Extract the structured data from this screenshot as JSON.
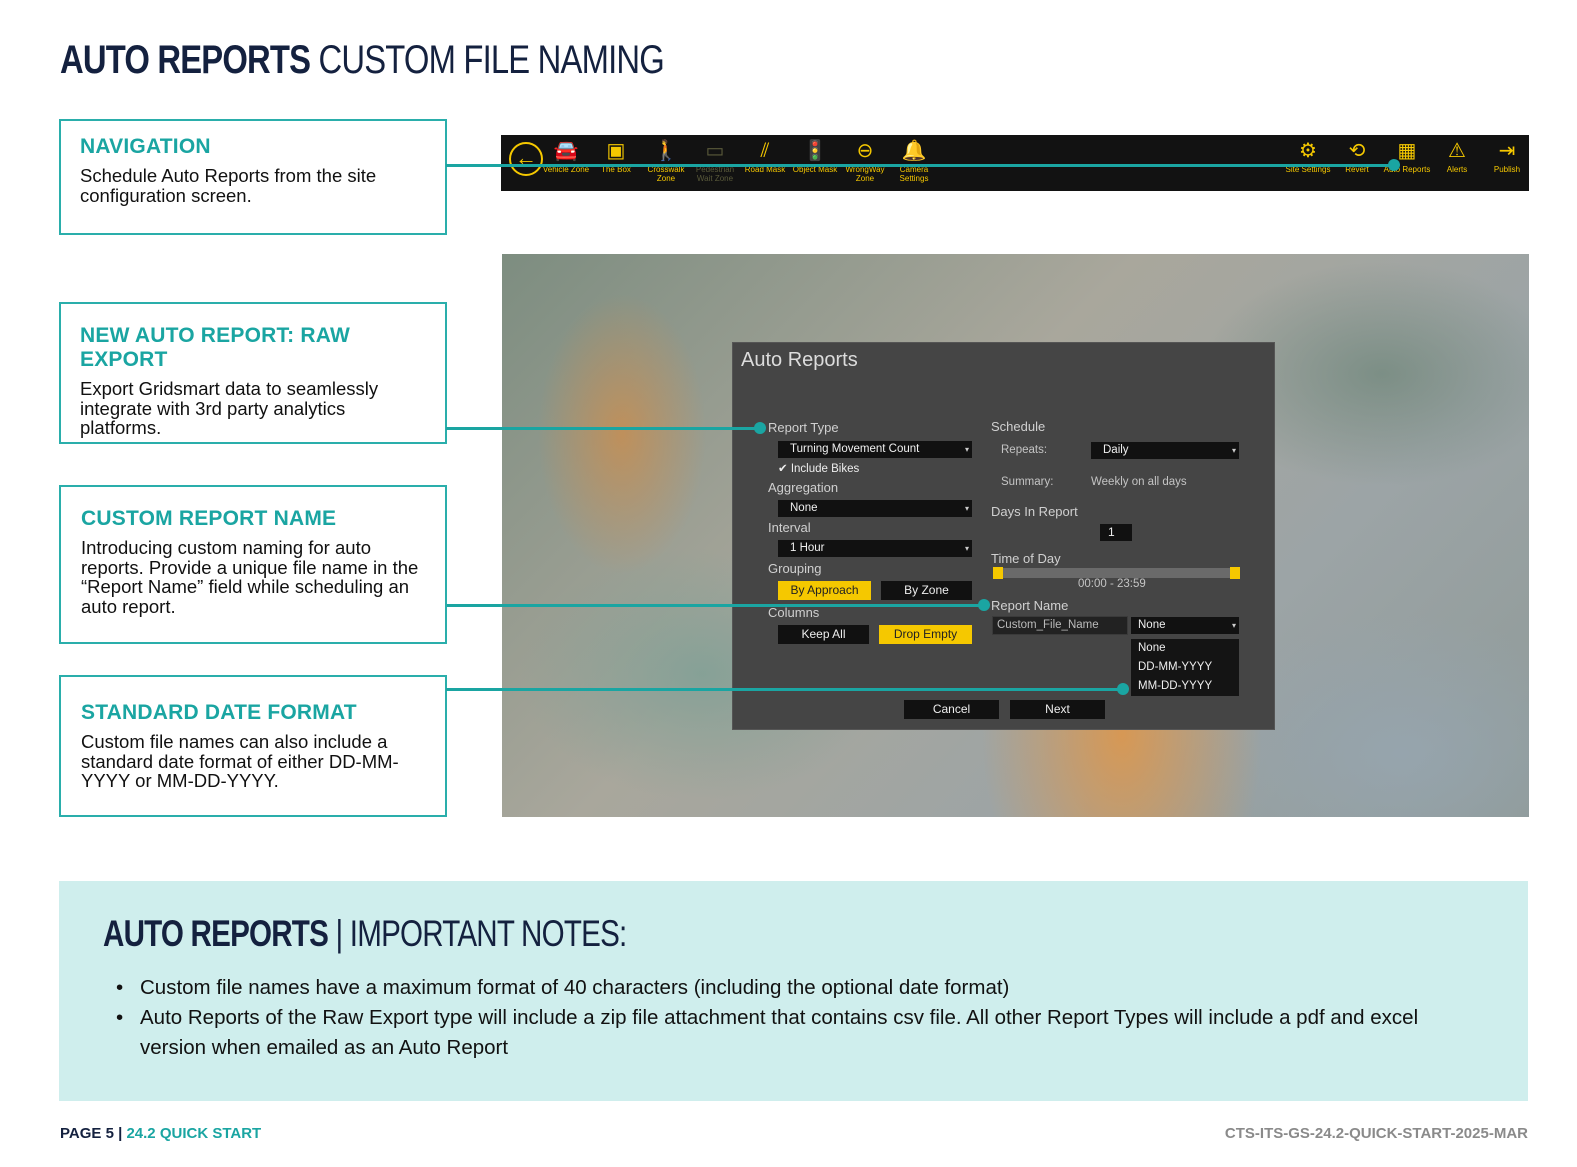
{
  "title": {
    "bold": "AUTO REPORTS",
    "light": "CUSTOM FILE NAMING"
  },
  "callouts": [
    {
      "heading": "NAVIGATION",
      "body": "Schedule Auto Reports from the site configuration screen."
    },
    {
      "heading": "NEW AUTO REPORT: RAW EXPORT",
      "body": "Export Gridsmart data to seamlessly integrate with 3rd party analytics platforms."
    },
    {
      "heading": "CUSTOM REPORT NAME",
      "body": "Introducing custom naming for auto reports. Provide a unique file name in the “Report Name” field while scheduling an auto report."
    },
    {
      "heading": "STANDARD DATE FORMAT",
      "body": "Custom file names can also include a standard date format of either DD-MM-YYYY or MM-DD-YYYY."
    }
  ],
  "toolbar": {
    "left_items": [
      {
        "icon": "car-icon",
        "glyph": "🚘",
        "label": "Vehicle Zone"
      },
      {
        "icon": "box-icon",
        "glyph": "▣",
        "label": "The Box"
      },
      {
        "icon": "crosswalk-icon",
        "glyph": "🚶",
        "label": "Crosswalk Zone"
      },
      {
        "icon": "pedestrian-wait-icon",
        "glyph": "▭",
        "label": "Pedestrian Wait Zone"
      },
      {
        "icon": "road-mask-icon",
        "glyph": "⫽",
        "label": "Road Mask"
      },
      {
        "icon": "object-mask-icon",
        "glyph": "🚦",
        "label": "Object Mask"
      },
      {
        "icon": "wrong-way-icon",
        "glyph": "⊖",
        "label": "WrongWay Zone"
      },
      {
        "icon": "bell-icon",
        "glyph": "🔔",
        "label": "Camera Settings"
      }
    ],
    "right_items": [
      {
        "icon": "gear-icon",
        "glyph": "⚙",
        "label": "Site Settings"
      },
      {
        "icon": "revert-icon",
        "glyph": "⟲",
        "label": "Revert"
      },
      {
        "icon": "auto-reports-icon",
        "glyph": "▦",
        "label": "Auto Reports"
      },
      {
        "icon": "alert-icon",
        "glyph": "⚠",
        "label": "Alerts"
      },
      {
        "icon": "publish-icon",
        "glyph": "⇥",
        "label": "Publish"
      }
    ]
  },
  "dialog": {
    "title": "Auto Reports",
    "report_type_label": "Report Type",
    "report_type_value": "Turning Movement Count",
    "include_bikes": "Include Bikes",
    "aggregation_label": "Aggregation",
    "aggregation_value": "None",
    "interval_label": "Interval",
    "interval_value": "1 Hour",
    "grouping_label": "Grouping",
    "grouping_options": [
      "By Approach",
      "By Zone"
    ],
    "columns_label": "Columns",
    "columns_options": [
      "Keep All",
      "Drop Empty"
    ],
    "schedule_label": "Schedule",
    "repeats_label": "Repeats:",
    "repeats_value": "Daily",
    "summary_label": "Summary:",
    "summary_value": "Weekly on all days",
    "days_label": "Days In Report",
    "days_value": "1",
    "time_label": "Time of Day",
    "time_range": "00:00 - 23:59",
    "report_name_label": "Report Name",
    "report_name_value": "Custom_File_Name",
    "date_format_value": "None",
    "date_format_options": [
      "None",
      "DD-MM-YYYY",
      "MM-DD-YYYY"
    ],
    "cancel": "Cancel",
    "next": "Next"
  },
  "notes": {
    "title_bold": "AUTO REPORTS",
    "title_sep": "|",
    "title_light": "IMPORTANT NOTES:",
    "items": [
      "Custom file names have a maximum format of 40 characters (including the optional date format)",
      "Auto Reports of the Raw Export type will include a zip file attachment that contains csv file. All other Report Types will include a pdf and excel version when emailed as an Auto Report"
    ]
  },
  "footer": {
    "page": "PAGE 5",
    "sep": "|",
    "doc": "24.2 QUICK START",
    "code": "CTS-ITS-GS-24.2-QUICK-START-2025-MAR"
  },
  "colors": {
    "accent": "#1aa5a2",
    "navy": "#14213f",
    "toolbar_yellow": "#f5c800",
    "notes_bg": "#cfeeed"
  }
}
